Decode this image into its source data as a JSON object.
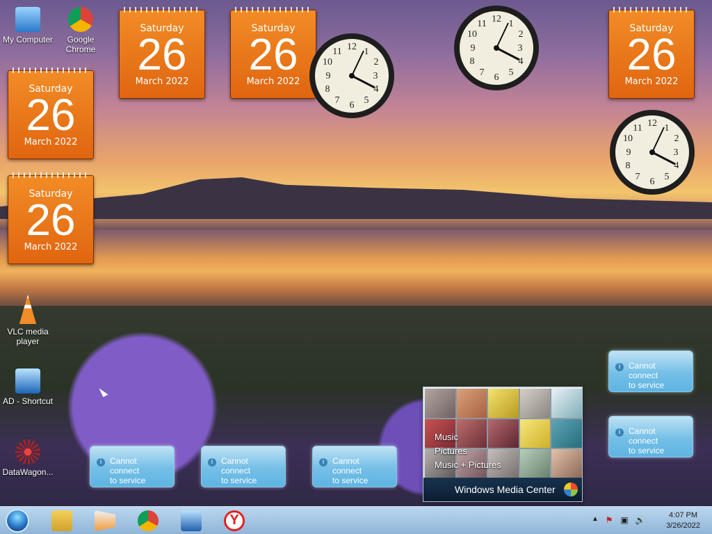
{
  "desktop": {
    "icons": [
      {
        "label": "My Computer",
        "icon": "computer-icon"
      },
      {
        "label": "Google\nChrome",
        "icon": "chrome-icon"
      },
      {
        "label": "VLC media\nplayer",
        "icon": "vlc-icon"
      },
      {
        "label": "AD - Shortcut",
        "icon": "computer-shortcut-icon"
      },
      {
        "label": "DataWagon...",
        "icon": "datawagon-icon"
      }
    ],
    "calendars": [
      {
        "day": "Saturday",
        "date": "26",
        "month": "March 2022"
      },
      {
        "day": "Saturday",
        "date": "26",
        "month": "March 2022"
      },
      {
        "day": "Saturday",
        "date": "26",
        "month": "March 2022"
      },
      {
        "day": "Saturday",
        "date": "26",
        "month": "March 2022"
      },
      {
        "day": "Saturday",
        "date": "26",
        "month": "March 2022"
      }
    ],
    "clocks": [
      {
        "time": "4:07"
      },
      {
        "time": "4:07"
      },
      {
        "time": "4:07"
      }
    ],
    "service_gadgets": [
      {
        "text": "Cannot connect\nto service"
      },
      {
        "text": "Cannot connect\nto service"
      },
      {
        "text": "Cannot connect\nto service"
      },
      {
        "text": "Cannot connect\nto service"
      },
      {
        "text": "Cannot connect\nto service"
      }
    ],
    "media_center": {
      "items": [
        "Music",
        "Pictures",
        "Music + Pictures"
      ],
      "title": "Windows Media Center"
    }
  },
  "taskbar": {
    "time": "4:07 PM",
    "date": "3/26/2022",
    "apps": [
      "explorer-icon",
      "media-player-icon",
      "chrome-icon",
      "remote-desktop-icon",
      "yandex-icon"
    ],
    "tray": [
      "show-hidden-icons-icon",
      "action-center-icon",
      "network-icon",
      "volume-icon"
    ]
  },
  "colors": {
    "calendar": "#e06510",
    "taskbar": "#9fc3e4",
    "gadget": "#74bfe7"
  }
}
